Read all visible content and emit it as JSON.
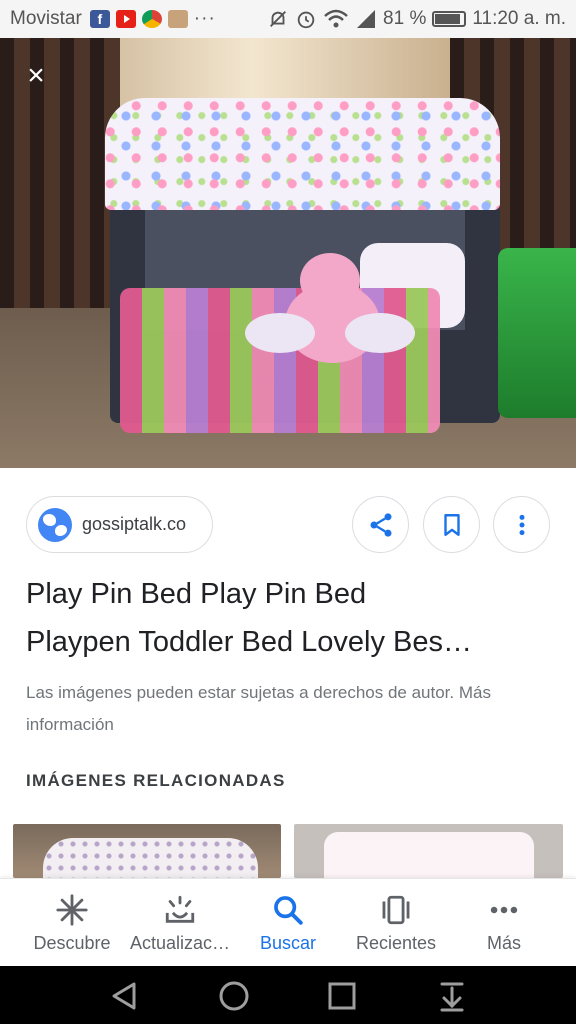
{
  "status_bar": {
    "carrier": "Movistar",
    "facebook_letter": "f",
    "dots": "···",
    "battery_percent": "81 %",
    "battery_level": 0.81,
    "time": "11:20 a. m.",
    "icons": [
      "facebook-icon",
      "youtube-icon",
      "chrome-icon",
      "image-icon",
      "mute-icon",
      "alarm-icon",
      "wifi-icon",
      "signal-icon",
      "battery-icon"
    ]
  },
  "viewer": {
    "close_icon": "×"
  },
  "source": {
    "domain": "gossiptalk.co",
    "icon": "globe-icon"
  },
  "actions": {
    "share_icon": "share-icon",
    "save_icon": "bookmark-icon",
    "more_icon": "more-vert-icon"
  },
  "result": {
    "title_line1": "Play Pin Bed Play Pin Bed",
    "title_line2": "Playpen Toddler Bed Lovely Bes…",
    "copyright": "Las imágenes pueden estar sujetas a derechos de autor. Más información"
  },
  "related": {
    "heading": "IMÁGENES RELACIONADAS"
  },
  "bottom_nav": {
    "items": [
      {
        "label": "Descubre",
        "icon": "asterisk-icon"
      },
      {
        "label": "Actualizac…",
        "icon": "updates-icon"
      },
      {
        "label": "Buscar",
        "icon": "search-icon"
      },
      {
        "label": "Recientes",
        "icon": "recents-icon"
      },
      {
        "label": "Más",
        "icon": "more-horiz-icon"
      }
    ],
    "active_index": 2
  },
  "colors": {
    "accent": "#1a73e8",
    "text": "#202124",
    "muted": "#70757a"
  }
}
